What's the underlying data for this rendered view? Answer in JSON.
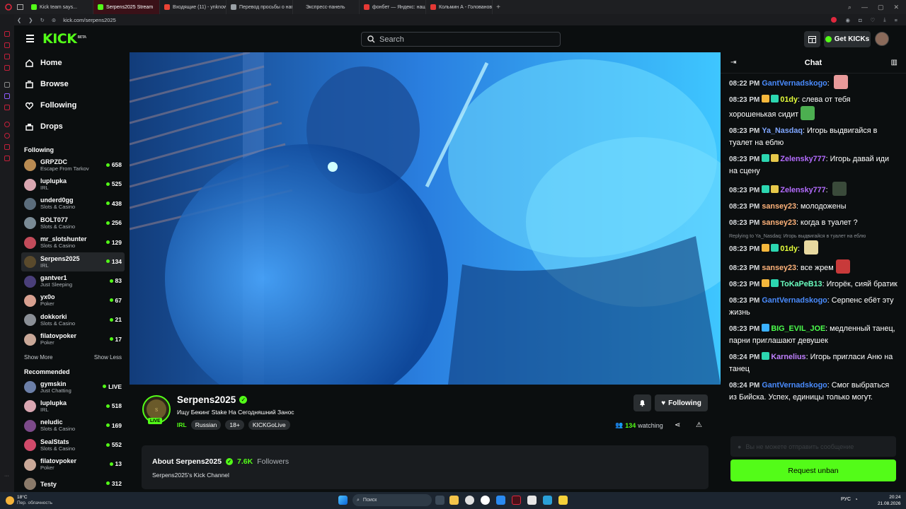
{
  "browser": {
    "tabs": [
      {
        "label": "Kick team says...",
        "color": "#53fc18"
      },
      {
        "label": "Serpens2025 Stream",
        "color": "#53fc18",
        "active": true
      },
      {
        "label": "Входящие (11) - ynknown",
        "color": "#ea4335"
      },
      {
        "label": "Перевод просьбы о напи",
        "color": "#9aa0a6"
      },
      {
        "label": "Экспресс-панель",
        "color": "#1e1f22"
      },
      {
        "label": "фонбет — Яндекс: нашлос",
        "color": "#e53935"
      },
      {
        "label": "Кольмин А - Голованов Г",
        "color": "#e53935"
      }
    ],
    "url": "kick.com/serpens2025"
  },
  "header": {
    "logo": "KICK",
    "logo_sup": "BETA",
    "search_placeholder": "Search",
    "get_kicks_label": "Get KICKs"
  },
  "nav": {
    "items": [
      {
        "label": "Home",
        "icon": "home-icon"
      },
      {
        "label": "Browse",
        "icon": "browse-icon"
      },
      {
        "label": "Following",
        "icon": "heart-icon"
      },
      {
        "label": "Drops",
        "icon": "drops-icon"
      }
    ],
    "following_title": "Following",
    "following": [
      {
        "name": "GRPZDC",
        "category": "Escape From Tarkov",
        "viewers": "658",
        "color": "#b98b52"
      },
      {
        "name": "luplupka",
        "category": "IRL",
        "viewers": "525",
        "color": "#d9a6b1"
      },
      {
        "name": "underd0gg",
        "category": "Slots & Casino",
        "viewers": "438",
        "color": "#5b6d7c"
      },
      {
        "name": "BOLT077",
        "category": "Slots & Casino",
        "viewers": "256",
        "color": "#7a8b96"
      },
      {
        "name": "mr_slotshunter",
        "category": "Slots & Casino",
        "viewers": "129",
        "color": "#c24b5a"
      },
      {
        "name": "Serpens2025",
        "category": "IRL",
        "viewers": "134",
        "color": "#5a4a2c",
        "selected": true
      },
      {
        "name": "gantver1",
        "category": "Just Sleeping",
        "viewers": "83",
        "color": "#4a3f7a"
      },
      {
        "name": "yx0o",
        "category": "Poker",
        "viewers": "67",
        "color": "#d7a090"
      },
      {
        "name": "dokkorki",
        "category": "Slots & Casino",
        "viewers": "21",
        "color": "#8a8f96"
      },
      {
        "name": "filatovpoker",
        "category": "Poker",
        "viewers": "17",
        "color": "#c9a898"
      }
    ],
    "show_more": "Show More",
    "show_less": "Show Less",
    "recommended_title": "Recommended",
    "recommended": [
      {
        "name": "gymskin",
        "category": "Just Chatting",
        "viewers": "LIVE",
        "color": "#6b7fa8"
      },
      {
        "name": "luplupka",
        "category": "IRL",
        "viewers": "518",
        "color": "#d9a6b1"
      },
      {
        "name": "neludic",
        "category": "Slots & Casino",
        "viewers": "169",
        "color": "#7c4a8a"
      },
      {
        "name": "SealStats",
        "category": "Slots & Casino",
        "viewers": "552",
        "color": "#d04a6a"
      },
      {
        "name": "filatovpoker",
        "category": "Poker",
        "viewers": "13",
        "color": "#c9a898"
      },
      {
        "name": "Testy",
        "category": "",
        "viewers": "312",
        "color": "#8a7a6a"
      }
    ]
  },
  "stream": {
    "channel": "Serpens2025",
    "title": "Ищу Бекинг Stake На Сегодняшний Занос",
    "category": "IRL",
    "tags": [
      "Russian",
      "18+",
      "KICKGoLive"
    ],
    "live_badge": "LIVE",
    "viewers": "134",
    "watching_label": "watching",
    "following_label": "Following",
    "about_title": "About Serpens2025",
    "followers_count": "7.6K",
    "followers_label": "Followers",
    "about_text": "Serpens2025's Kick Channel"
  },
  "chat": {
    "title": "Chat",
    "messages": [
      {
        "time": "08:22 PM",
        "user": "GantVernadskogo",
        "color": "#4a8cff",
        "text": "",
        "emote": "#e89a9a"
      },
      {
        "time": "08:23 PM",
        "user": "01dy",
        "color": "#e6ff3a",
        "text": "слева от тебя хорошенькая сидит",
        "badges": [
          "#f4b73c",
          "#2cd6b0"
        ],
        "emote": "#4caf50"
      },
      {
        "time": "08:23 PM",
        "user": "Ya_Nasdaq",
        "color": "#7fa6ff",
        "text": "Игорь выдвигайся в туалет на еблю"
      },
      {
        "time": "08:23 PM",
        "user": "Zelensky777",
        "color": "#b46cff",
        "text": "Игорь давай иди на сцену",
        "badges": [
          "#2cd6b0",
          "#e6c84a"
        ]
      },
      {
        "time": "08:23 PM",
        "user": "Zelensky777",
        "color": "#b46cff",
        "text": "",
        "badges": [
          "#2cd6b0",
          "#e6c84a"
        ],
        "emote": "#3a4a3a"
      },
      {
        "time": "08:23 PM",
        "user": "sansey23",
        "color": "#ffb37a",
        "text": "молодожены"
      },
      {
        "time": "08:23 PM",
        "user": "sansey23",
        "color": "#ffb37a",
        "text": "когда в туалет ?"
      },
      {
        "reply": "Replying to Ya_Nasdaq: Игорь выдвигайся в туалет на еблю",
        "time": "08:23 PM",
        "user": "01dy",
        "color": "#e6ff3a",
        "text": "",
        "badges": [
          "#f4b73c",
          "#2cd6b0"
        ],
        "emote": "#e8d9a0"
      },
      {
        "time": "08:23 PM",
        "user": "sansey23",
        "color": "#ffb37a",
        "text": "все жрем",
        "emote": "#c83a3a"
      },
      {
        "time": "08:23 PM",
        "user": "ToKaPeB13",
        "color": "#6affc0",
        "text": "Игорёк, сияй братик",
        "badges": [
          "#f4b73c",
          "#2cd6b0"
        ]
      },
      {
        "time": "08:23 PM",
        "user": "GantVernadskogo",
        "color": "#4a8cff",
        "text": "Серпенс ебёт эту жизнь"
      },
      {
        "time": "08:23 PM",
        "user": "BIG_EVIL_JOE",
        "color": "#4cff4c",
        "text": "медленный танец, парни приглашают девушек",
        "badges": [
          "#3ab0ff"
        ]
      },
      {
        "time": "08:24 PM",
        "user": "Karnelius",
        "color": "#c080ff",
        "text": "Игорь пригласи Аню на танец",
        "badges": [
          "#2cd6b0"
        ]
      },
      {
        "time": "08:24 PM",
        "user": "GantVernadskogo",
        "color": "#4a8cff",
        "text": "Смог выбраться из Бийска. Успех, единицы только могут."
      }
    ],
    "input_placeholder": "Вы не можете отправить сообщение",
    "unban_label": "Request unban"
  },
  "taskbar": {
    "weather_temp": "18°C",
    "weather_desc": "Пер. облачность",
    "search_label": "Поиск",
    "lang": "РУС",
    "time": "20:24",
    "date": "21.08.2026"
  }
}
